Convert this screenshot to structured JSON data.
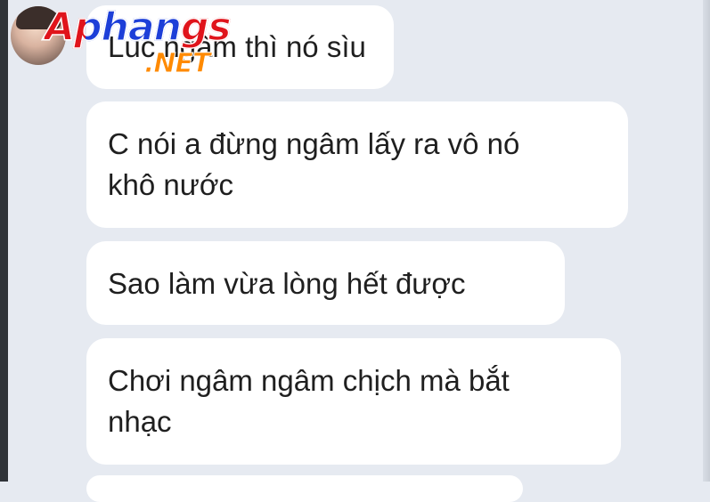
{
  "chat": {
    "messages": [
      {
        "text": "Lúc ngâm thì nó sìu"
      },
      {
        "text": "C nói a đừng ngâm lấy ra vô nó\nkhô nước"
      },
      {
        "text": "Sao làm vừa lòng hết được"
      },
      {
        "text": "Chơi ngâm ngâm chịch mà bắt\nnhạc"
      },
      {
        "text": ""
      }
    ]
  },
  "watermark": {
    "main": "Aphangs",
    "sub": ".NET"
  },
  "colors": {
    "background": "#e6eaf1",
    "bubble": "#ffffff",
    "text": "#1f1f1f",
    "watermark_red": "#e0141b",
    "watermark_blue": "#1d3fd8",
    "watermark_orange": "#ff8a00"
  }
}
